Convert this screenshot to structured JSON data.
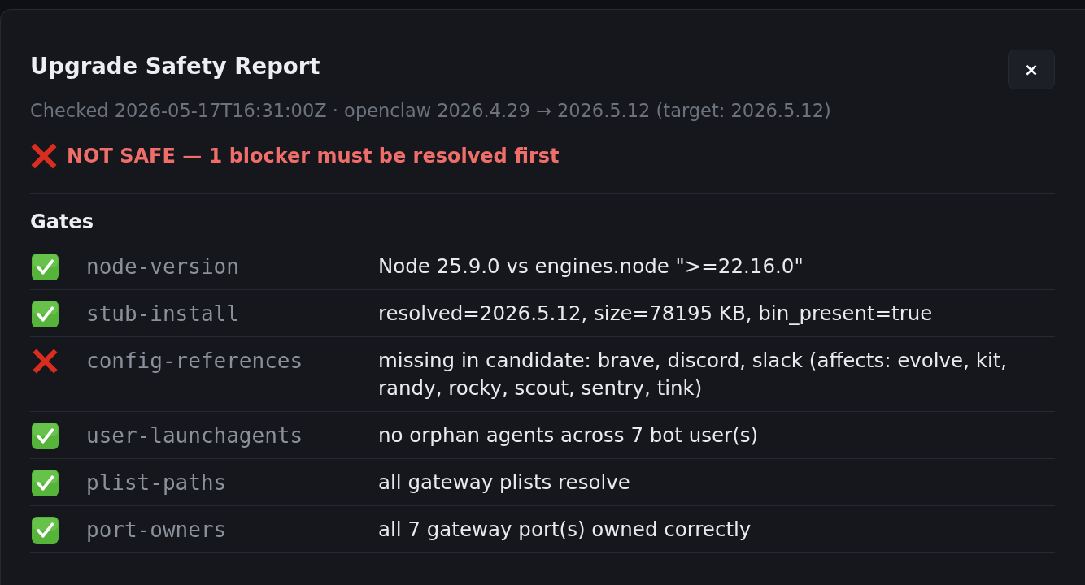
{
  "dialog": {
    "title": "Upgrade Safety Report",
    "close_button": "×",
    "subtitle": "Checked 2026-05-17T16:31:00Z · openclaw 2026.4.29 → 2026.5.12 (target: 2026.5.12)",
    "verdict": {
      "safe": false,
      "text": "NOT SAFE — 1 blocker must be resolved first"
    }
  },
  "gates": {
    "heading": "Gates",
    "rows": [
      {
        "passed": true,
        "name": "node-version",
        "detail": "Node 25.9.0 vs engines.node \">=22.16.0\""
      },
      {
        "passed": true,
        "name": "stub-install",
        "detail": "resolved=2026.5.12, size=78195 KB, bin_present=true"
      },
      {
        "passed": false,
        "name": "config-references",
        "detail": "missing in candidate: brave, discord, slack (affects: evolve, kit, randy, rocky, scout, sentry, tink)"
      },
      {
        "passed": true,
        "name": "user-launchagents",
        "detail": "no orphan agents across 7 bot user(s)"
      },
      {
        "passed": true,
        "name": "plist-paths",
        "detail": "all gateway plists resolve"
      },
      {
        "passed": true,
        "name": "port-owners",
        "detail": "all 7 gateway port(s) owned correctly"
      }
    ]
  }
}
